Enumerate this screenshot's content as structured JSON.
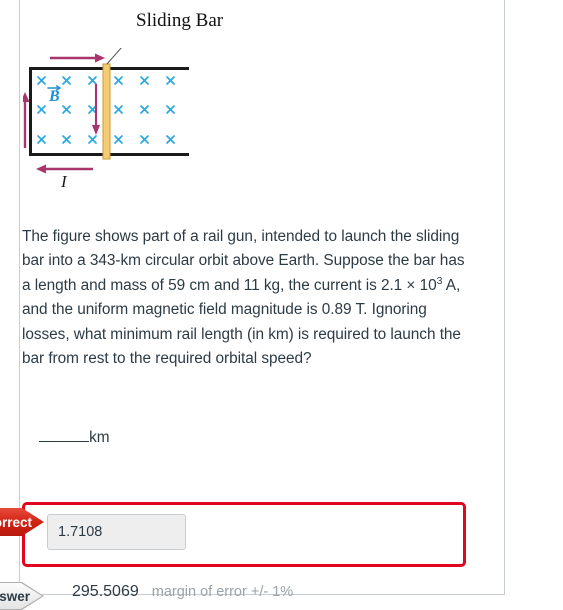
{
  "figure": {
    "title_label": "Sliding Bar",
    "field_label": "B",
    "current_label": "I",
    "cross_symbol": "×",
    "grid_rows": 3,
    "grid_cols": 6,
    "bar_after_col": 3,
    "colors": {
      "rail": "#1a1a1a",
      "cross": "#29a8e0",
      "field_label": "#1f8fd4",
      "arrow": "#a8356b",
      "bar_fill": "#f5cc73",
      "bar_edge": "#c79a33",
      "leader": "#555555"
    }
  },
  "question": {
    "paragraph_part1": "The figure shows part of a rail gun, intended to launch the sliding bar into a 343-km circular orbit above Earth. Suppose the bar has a length and mass of 59 cm and 11 kg, the current is 2.1 × 10",
    "exponent": "3",
    "paragraph_part2": " A, and the uniform magnetic field magnitude is 0.89 T. Ignoring losses, what minimum rail length (in km) is required to launch the bar from rest to the required orbital speed?",
    "answer_unit": "km"
  },
  "feedback": {
    "incorrect_badge": "Incorrect",
    "correct_badge": "Correct answer",
    "submitted_value": "1.7108",
    "correct_value": "295.5069",
    "margin_text": "margin of error +/- 1%",
    "error_border_color": "#e0061f"
  }
}
